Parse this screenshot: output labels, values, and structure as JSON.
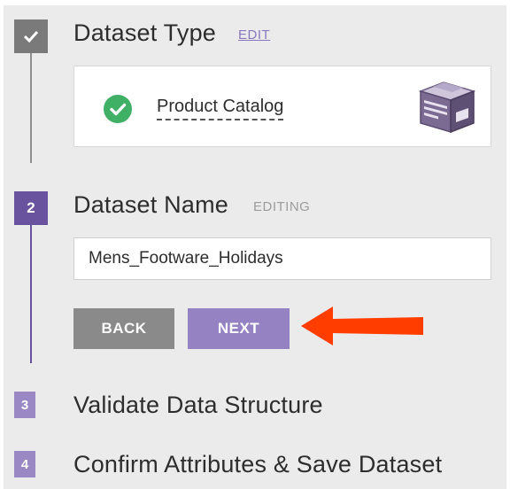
{
  "steps": [
    {
      "number": "✓",
      "title": "Dataset Type",
      "tag": "EDIT",
      "status": "complete"
    },
    {
      "number": "2",
      "title": "Dataset Name",
      "tag": "EDITING",
      "status": "active"
    },
    {
      "number": "3",
      "title": "Validate Data Structure",
      "status": "pending"
    },
    {
      "number": "4",
      "title": "Confirm Attributes & Save Dataset",
      "status": "pending"
    }
  ],
  "dataset_type": {
    "selected": "Product Catalog",
    "status_icon": "check-circle-icon",
    "icon": "box-icon"
  },
  "dataset_name": {
    "value": "Mens_Footware_Holidays"
  },
  "buttons": {
    "back_label": "BACK",
    "next_label": "NEXT"
  },
  "annotation": {
    "arrow_color": "#ff3d00"
  },
  "colors": {
    "background": "#ebebeb",
    "complete": "#7a7a7a",
    "active": "#6a539e",
    "pending": "#9a88c4",
    "success": "#3fb065"
  }
}
